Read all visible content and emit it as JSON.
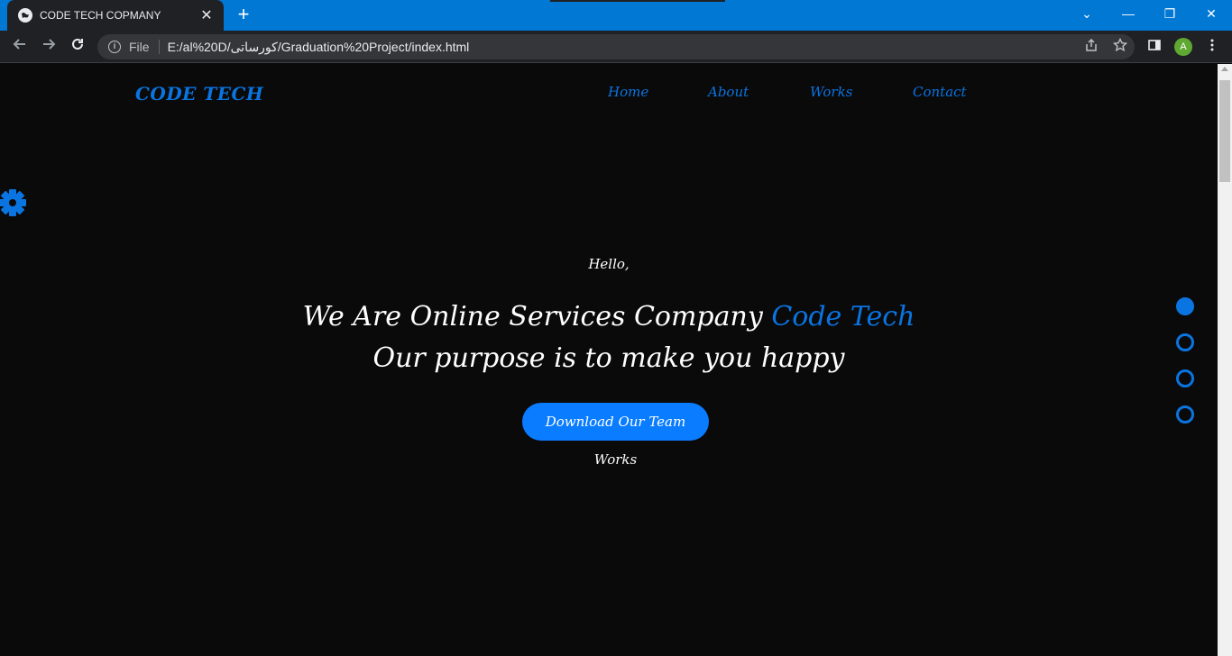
{
  "browser": {
    "tab_title": "CODE TECH COPMANY",
    "tab_close": "✕",
    "new_tab": "+",
    "url_scheme_label": "File",
    "url": "E:/al%20D/کورساتی/Graduation%20Project/index.html",
    "profile_initial": "A",
    "window_controls": {
      "tabsearch": "⌄",
      "minimize": "—",
      "restore": "❐",
      "close": "✕"
    }
  },
  "site": {
    "logo": "CODE TECH",
    "nav": [
      "Home",
      "About",
      "Works",
      "Contact"
    ]
  },
  "hero": {
    "greeting": "Hello,",
    "line1_prefix": "We Are Online Services Company ",
    "line1_accent": "Code Tech",
    "line2": "Our purpose is to make you happy",
    "cta_label": "Download Our Team Works"
  },
  "slider": {
    "count": 4,
    "active_index": 0
  },
  "colors": {
    "accent": "#0a74e0",
    "button": "#0a7cff",
    "background": "#0a0a0b",
    "titlebar": "#0078d4"
  },
  "icons": {
    "settings": "gear-icon",
    "back": "arrow-left-icon",
    "forward": "arrow-right-icon",
    "reload": "reload-icon",
    "share": "share-icon",
    "bookmark": "star-icon",
    "sidepanel": "sidepanel-icon",
    "menu": "kebab-menu-icon"
  }
}
